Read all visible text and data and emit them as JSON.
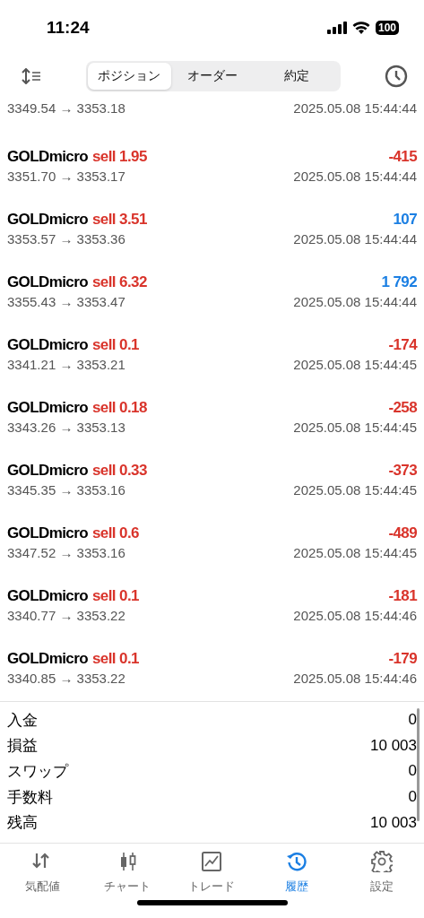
{
  "status_bar": {
    "time": "11:24",
    "battery": "100"
  },
  "toolbar": {
    "segments": [
      {
        "label": "ポジション",
        "selected": true
      },
      {
        "label": "オーダー",
        "selected": false
      },
      {
        "label": "約定",
        "selected": false
      }
    ]
  },
  "partial_row": {
    "prices": "3349.54 → 3353.18",
    "time": "2025.05.08 15:44:44"
  },
  "trades": [
    {
      "symbol": "GOLDmicro",
      "deal": "sell 1.95",
      "profit": "-415",
      "color": "#d9342b",
      "prices": "3351.70 → 3353.17",
      "time": "2025.05.08 15:44:44"
    },
    {
      "symbol": "GOLDmicro",
      "deal": "sell 3.51",
      "profit": "107",
      "color": "#1b7fe3",
      "prices": "3353.57 → 3353.36",
      "time": "2025.05.08 15:44:44"
    },
    {
      "symbol": "GOLDmicro",
      "deal": "sell 6.32",
      "profit": "1 792",
      "color": "#1b7fe3",
      "prices": "3355.43 → 3353.47",
      "time": "2025.05.08 15:44:44"
    },
    {
      "symbol": "GOLDmicro",
      "deal": "sell 0.1",
      "profit": "-174",
      "color": "#d9342b",
      "prices": "3341.21 → 3353.21",
      "time": "2025.05.08 15:44:45"
    },
    {
      "symbol": "GOLDmicro",
      "deal": "sell 0.18",
      "profit": "-258",
      "color": "#d9342b",
      "prices": "3343.26 → 3353.13",
      "time": "2025.05.08 15:44:45"
    },
    {
      "symbol": "GOLDmicro",
      "deal": "sell 0.33",
      "profit": "-373",
      "color": "#d9342b",
      "prices": "3345.35 → 3353.16",
      "time": "2025.05.08 15:44:45"
    },
    {
      "symbol": "GOLDmicro",
      "deal": "sell 0.6",
      "profit": "-489",
      "color": "#d9342b",
      "prices": "3347.52 → 3353.16",
      "time": "2025.05.08 15:44:45"
    },
    {
      "symbol": "GOLDmicro",
      "deal": "sell 0.1",
      "profit": "-181",
      "color": "#d9342b",
      "prices": "3340.77 → 3353.22",
      "time": "2025.05.08 15:44:46"
    },
    {
      "symbol": "GOLDmicro",
      "deal": "sell 0.1",
      "profit": "-179",
      "color": "#d9342b",
      "prices": "3340.85 → 3353.22",
      "time": "2025.05.08 15:44:46"
    }
  ],
  "summary": [
    {
      "label": "入金",
      "value": "0"
    },
    {
      "label": "損益",
      "value": "10 003"
    },
    {
      "label": "スワップ",
      "value": "0"
    },
    {
      "label": "手数料",
      "value": "0"
    },
    {
      "label": "残高",
      "value": "10 003"
    }
  ],
  "tab_bar": [
    {
      "kind": "quotes",
      "label": "気配値",
      "selected": false
    },
    {
      "kind": "chart",
      "label": "チャート",
      "selected": false
    },
    {
      "kind": "trade",
      "label": "トレード",
      "selected": false
    },
    {
      "kind": "history",
      "label": "履歴",
      "selected": true
    },
    {
      "kind": "settings",
      "label": "設定",
      "selected": false
    }
  ]
}
